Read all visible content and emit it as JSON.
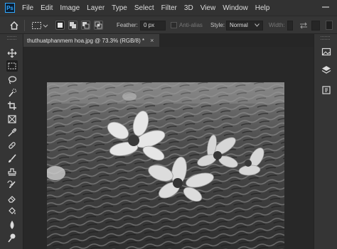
{
  "app": {
    "logo_text": "Ps"
  },
  "menu": [
    "File",
    "Edit",
    "Image",
    "Layer",
    "Type",
    "Select",
    "Filter",
    "3D",
    "View",
    "Window",
    "Help"
  ],
  "options": {
    "feather_label": "Feather:",
    "feather_value": "0 px",
    "antialias_label": "Anti-alias",
    "style_label": "Style:",
    "style_value": "Normal",
    "width_label": "Width:"
  },
  "document": {
    "tab_title": "thuthuatphanmem hoa.jpg @ 73.3% (RGB/8) *",
    "close": "×"
  },
  "tools": [
    "move-tool",
    "rectangular-marquee-tool",
    "lasso-tool",
    "quick-selection-tool",
    "crop-tool",
    "frame-tool",
    "eyedropper-tool",
    "spot-healing-brush-tool",
    "brush-tool",
    "clone-stamp-tool",
    "history-brush-tool",
    "eraser-tool",
    "paint-bucket-tool",
    "blur-tool",
    "dodge-tool"
  ],
  "right_panel": [
    "image-panel-icon",
    "layers-panel-icon",
    "history-panel-icon"
  ],
  "colors": {
    "menubar": "#323232",
    "panel": "#353535",
    "workspace": "#282828",
    "accent": "#31a8ff"
  }
}
